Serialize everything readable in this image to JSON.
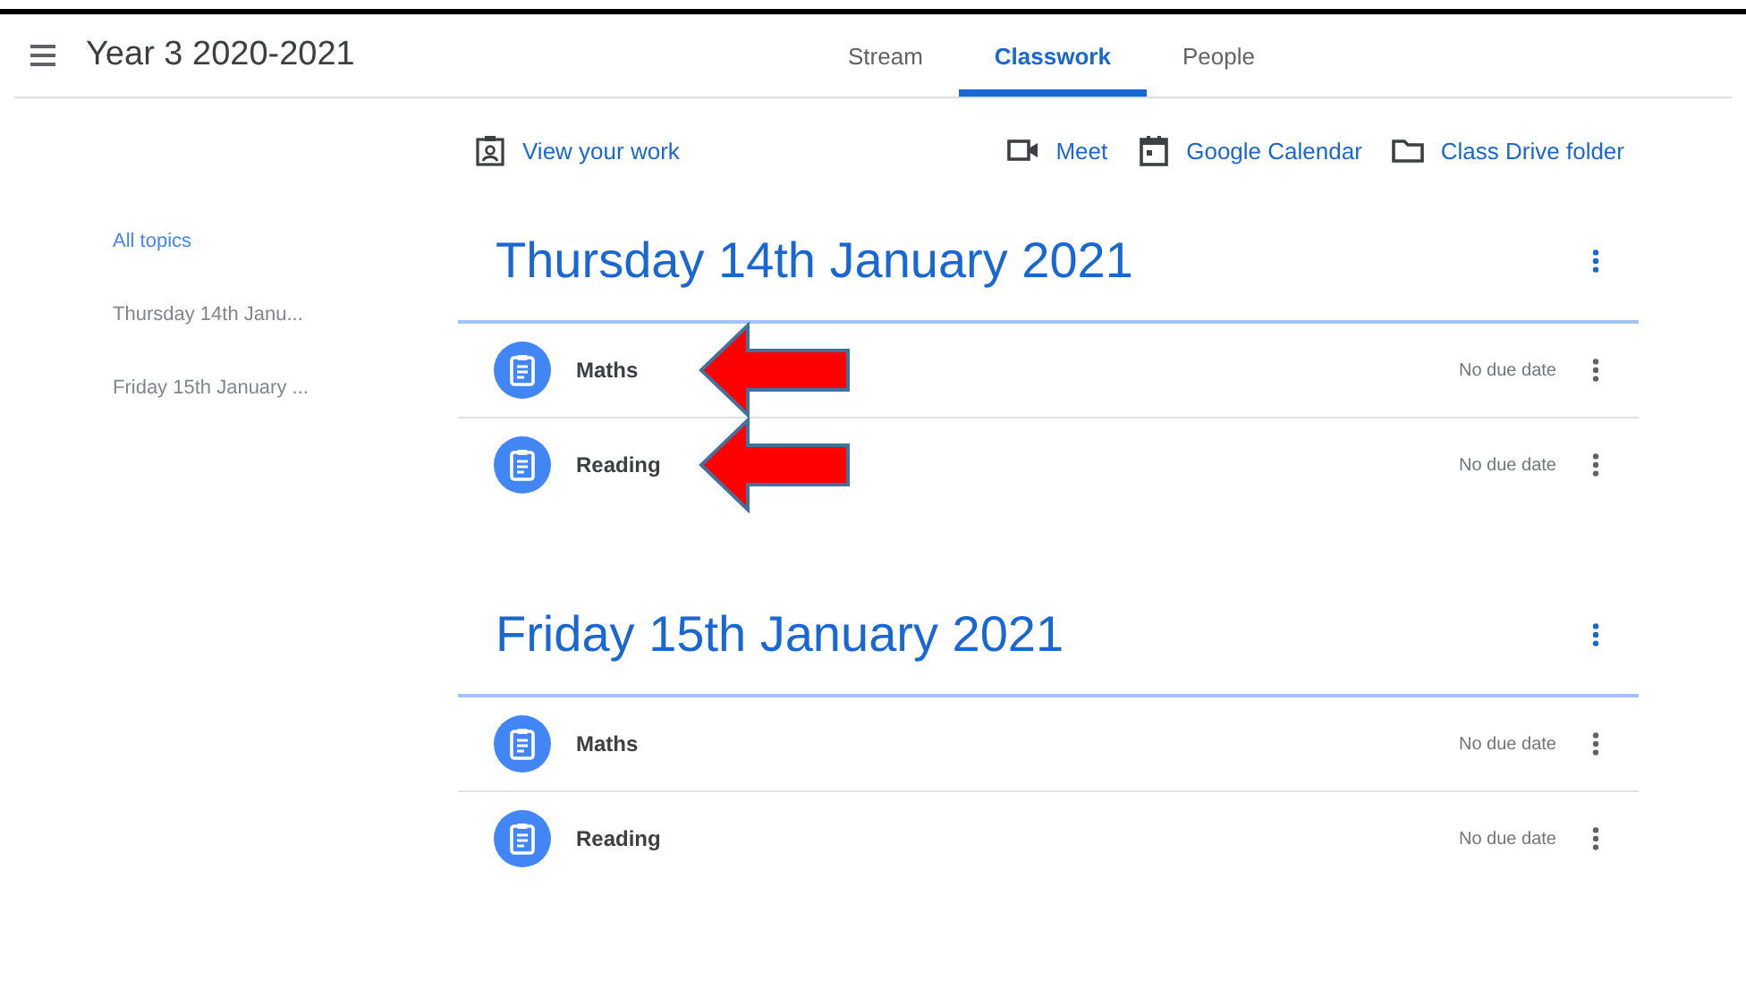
{
  "header": {
    "title": "Year 3 2020-2021"
  },
  "tabs": [
    {
      "label": "Stream",
      "selected": false
    },
    {
      "label": "Classwork",
      "selected": true
    },
    {
      "label": "People",
      "selected": false
    }
  ],
  "toolbar": {
    "view_work": "View your work",
    "links": [
      {
        "kind": "meet",
        "label": "Meet"
      },
      {
        "kind": "calendar",
        "label": "Google Calendar"
      },
      {
        "kind": "folder",
        "label": "Class Drive folder"
      }
    ]
  },
  "sidebar": {
    "items": [
      {
        "label": "All topics",
        "selected": true
      },
      {
        "label": "Thursday 14th Janu...",
        "selected": false
      },
      {
        "label": "Friday 15th January ...",
        "selected": false
      }
    ]
  },
  "topics": [
    {
      "title": "Thursday 14th January 2021",
      "items": [
        {
          "title": "Maths",
          "due": "No due date",
          "arrow": true
        },
        {
          "title": "Reading",
          "due": "No due date",
          "arrow": true
        }
      ]
    },
    {
      "title": "Friday 15th January 2021",
      "items": [
        {
          "title": "Maths",
          "due": "No due date",
          "arrow": false
        },
        {
          "title": "Reading",
          "due": "No due date",
          "arrow": false
        }
      ]
    }
  ]
}
